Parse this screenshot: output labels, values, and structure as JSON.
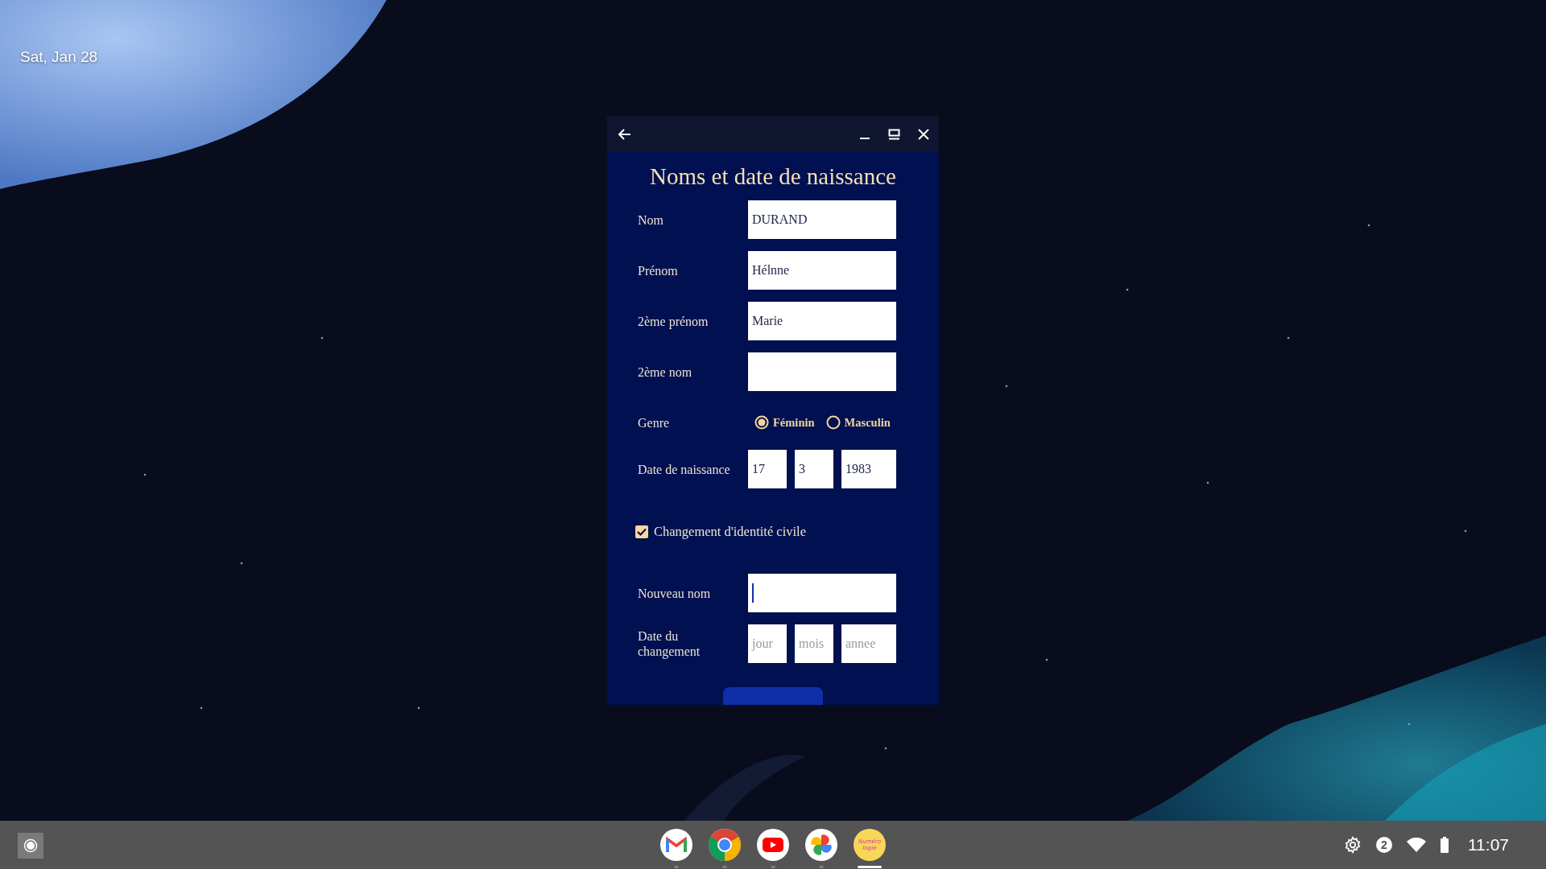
{
  "desktop": {
    "date": "Sat, Jan 28"
  },
  "window": {
    "title": "Noms et date de naissance"
  },
  "form": {
    "fields": [
      {
        "label": "Nom",
        "value": "DURAND"
      },
      {
        "label": "Prénom",
        "value": "Hélnne"
      },
      {
        "label": "2ème prénom",
        "value": "Marie"
      },
      {
        "label": "2ème nom"
      }
    ],
    "gender": {
      "label": "Genre",
      "options": [
        {
          "label": "Féminin",
          "selected": true
        },
        {
          "label": "Masculin",
          "selected": false
        }
      ]
    },
    "birth_date": {
      "label": "Date de naissance",
      "parts": [
        {
          "value": "17"
        },
        {
          "value": "3"
        },
        {
          "value": "1983"
        }
      ]
    },
    "identity_change": {
      "label": "Changement d'identité civile",
      "checked": true
    },
    "new_name": {
      "label": "Nouveau nom",
      "focused": true
    },
    "change_date": {
      "label": "Date du changement",
      "parts": [
        {
          "placeholder": "jour"
        },
        {
          "placeholder": "mois"
        },
        {
          "placeholder": "annee"
        }
      ]
    }
  },
  "shelf": {
    "apps": [
      {
        "kind": "mail",
        "active": false
      },
      {
        "kind": "browser",
        "active": false
      },
      {
        "kind": "video",
        "active": false
      },
      {
        "kind": "photos",
        "active": false
      },
      {
        "kind": "custom",
        "label": "Numéro logie",
        "active": true
      }
    ],
    "notifications": "2",
    "time": "11:07"
  }
}
